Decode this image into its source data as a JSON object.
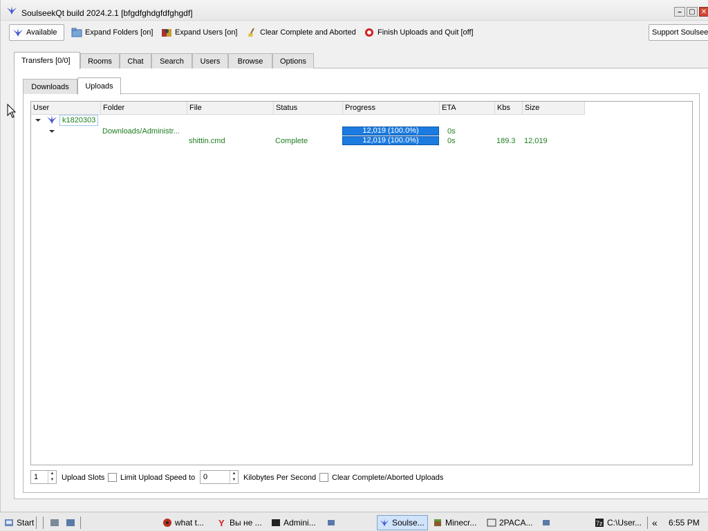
{
  "window": {
    "title": "SoulseekQt build 2024.2.1 [bfgdfghdgfdfghgdf]",
    "controls": [
      "minimize",
      "maximize",
      "close"
    ]
  },
  "toolbar": {
    "available": "Available",
    "expand_folders": "Expand Folders [on]",
    "expand_users": "Expand Users [on]",
    "clear_complete": "Clear Complete and Aborted",
    "finish_uploads": "Finish Uploads and Quit [off]",
    "support": "Support Soulseek"
  },
  "main_tabs": [
    "Transfers [0/0]",
    "Rooms",
    "Chat",
    "Search",
    "Users",
    "Browse",
    "Options"
  ],
  "sub_tabs": [
    "Downloads",
    "Uploads"
  ],
  "table": {
    "columns": [
      "User",
      "Folder",
      "File",
      "Status",
      "Progress",
      "ETA",
      "Kbs",
      "Size"
    ],
    "user": "k1820303",
    "folder_row": {
      "folder": "Downloads/Administr...",
      "progress": "12,019 (100.0%)",
      "eta": "0s"
    },
    "file_row": {
      "file": "shittin.cmd",
      "status": "Complete",
      "progress": "12,019 (100.0%)",
      "eta": "0s",
      "kbs": "189.3",
      "size": "12,019"
    }
  },
  "footer": {
    "upload_slots_value": "1",
    "upload_slots_label": "Upload Slots",
    "limit_label": "Limit Upload Speed to",
    "limit_value": "0",
    "kbps_label": "Kilobytes Per Second",
    "clear_label": "Clear Complete/Aborted Uploads"
  },
  "taskbar": {
    "start": "Start",
    "items": [
      "what t...",
      "Вы не ...",
      "Admini...",
      "Soulse...",
      "Minecr...",
      "2PACA...",
      "C:\\User..."
    ],
    "expand": "«",
    "time": "6:55 PM"
  },
  "colors": {
    "progress": "#1c7be0",
    "green_text": "#1e7d1e",
    "accent": "#4a5bd4"
  }
}
